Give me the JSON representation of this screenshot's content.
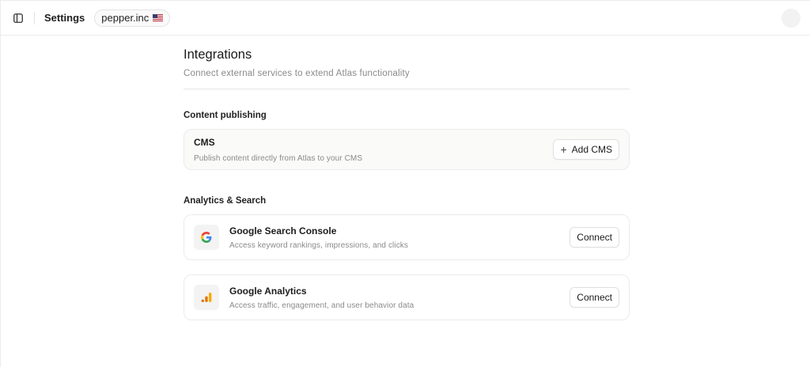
{
  "header": {
    "title": "Settings",
    "workspace": "pepper.inc",
    "flag": "🇺🇸"
  },
  "page": {
    "title": "Integrations",
    "subtitle": "Connect external services to extend Atlas functionality"
  },
  "sections": {
    "content_publishing": {
      "title": "Content publishing",
      "cms": {
        "title": "CMS",
        "description": "Publish content directly from Atlas to your CMS",
        "button": "Add CMS",
        "button_icon": "plus-icon"
      }
    },
    "analytics": {
      "title": "Analytics & Search",
      "gsc": {
        "title": "Google Search Console",
        "description": "Access keyword rankings, impressions, and clicks",
        "button": "Connect",
        "icon": "google-g-icon"
      },
      "ga": {
        "title": "Google Analytics",
        "description": "Access traffic, engagement, and user behavior data",
        "button": "Connect",
        "icon": "google-analytics-icon"
      }
    }
  },
  "colors": {
    "ga_orange": "#F9AB00",
    "ga_dark_orange": "#E37400",
    "google_blue": "#4285F4",
    "google_red": "#EA4335",
    "google_yellow": "#FBBC05",
    "google_green": "#34A853"
  }
}
